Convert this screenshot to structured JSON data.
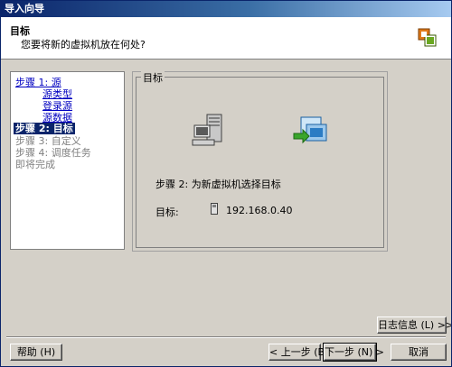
{
  "window": {
    "title": "导入向导"
  },
  "header": {
    "title": "目标",
    "subtitle": "您要将新的虚拟机放在何处?",
    "logo_icon": "vmware-logo-icon"
  },
  "steps": {
    "items": [
      {
        "label": "步骤 1: 源",
        "state": "link"
      },
      {
        "label": "源类型",
        "state": "link"
      },
      {
        "label": "登录源",
        "state": "link"
      },
      {
        "label": "源数据",
        "state": "link"
      },
      {
        "label": "步骤 2: 目标",
        "state": "active"
      },
      {
        "label": "步骤 3: 自定义",
        "state": "disabled"
      },
      {
        "label": "步骤 4: 调度任务",
        "state": "disabled"
      },
      {
        "label": "即将完成",
        "state": "disabled"
      }
    ]
  },
  "main": {
    "group_title": "目标",
    "icons": [
      "server-computer-icon",
      "import-vm-icon"
    ],
    "heading": "步骤 2: 为新虚拟机选择目标",
    "target_label": "目标:",
    "target_icon": "removable-drive-icon",
    "target_value": "192.168.0.40"
  },
  "buttons": {
    "log": "日志信息 (L) >>",
    "help": "帮助 (H)",
    "back": "< 上一步 (B)",
    "next": "下一步 (N) >",
    "cancel": "取消"
  }
}
